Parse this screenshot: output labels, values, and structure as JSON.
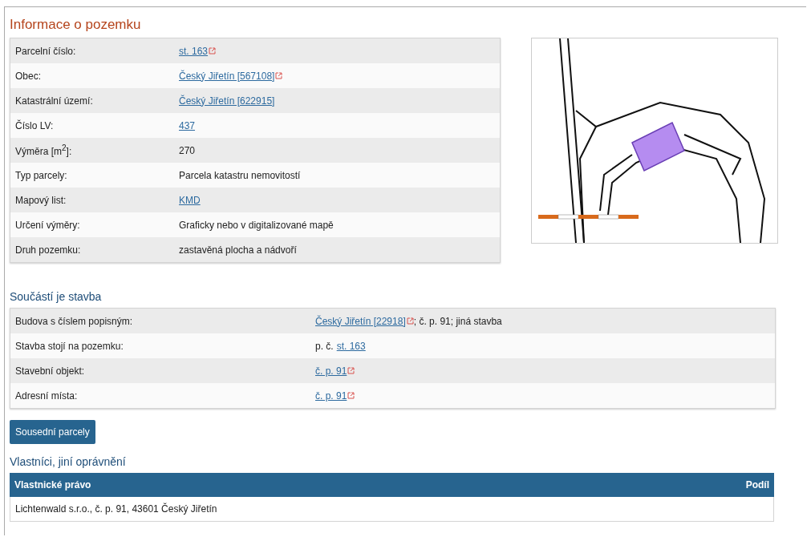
{
  "title": "Informace o pozemku",
  "parcel_rows": [
    {
      "label": "Parcelní číslo:",
      "value": [
        {
          "kind": "link",
          "text": "st. 163",
          "external": true
        }
      ]
    },
    {
      "label": "Obec:",
      "value": [
        {
          "kind": "link",
          "text": "Český Jiřetín [567108]",
          "external": true
        }
      ]
    },
    {
      "label": "Katastrální území:",
      "value": [
        {
          "kind": "link",
          "text": "Český Jiřetín [622915]",
          "external": false
        }
      ]
    },
    {
      "label": "Číslo LV:",
      "value": [
        {
          "kind": "link",
          "text": "437",
          "external": false
        }
      ]
    },
    {
      "label": "Výměra [m$^{2}$]:",
      "value": [
        {
          "kind": "text",
          "text": "270"
        }
      ]
    },
    {
      "label": "Typ parcely:",
      "value": [
        {
          "kind": "text",
          "text": "Parcela katastru nemovitostí"
        }
      ]
    },
    {
      "label": "Mapový list:",
      "value": [
        {
          "kind": "link",
          "text": "KMD",
          "external": false
        }
      ]
    },
    {
      "label": "Určení výměry:",
      "value": [
        {
          "kind": "text",
          "text": "Graficky nebo v digitalizované mapě"
        }
      ]
    },
    {
      "label": "Druh pozemku:",
      "value": [
        {
          "kind": "text",
          "text": "zastavěná plocha a nádvoří"
        }
      ]
    }
  ],
  "building": {
    "heading": "Součástí je stavba",
    "rows": [
      {
        "label": "Budova s číslem popisným:",
        "value": [
          {
            "kind": "link",
            "text": "Český Jiřetín [22918]",
            "external": true
          },
          {
            "kind": "text",
            "text": "; č. p. 91; jiná stavba"
          }
        ]
      },
      {
        "label": "Stavba stojí na pozemku:",
        "value": [
          {
            "kind": "text",
            "text": "p. č."
          },
          {
            "kind": "link",
            "text": "st. 163",
            "external": false
          }
        ]
      },
      {
        "label": "Stavební objekt:",
        "value": [
          {
            "kind": "link",
            "text": "č. p. 91",
            "external": true
          }
        ]
      },
      {
        "label": "Adresní místa:",
        "value": [
          {
            "kind": "link",
            "text": "č. p. 91",
            "external": true
          }
        ]
      }
    ]
  },
  "neighbours_button": "Sousední parcely",
  "owners": {
    "heading": "Vlastníci, jiní oprávnění",
    "columns": [
      "Vlastnické právo",
      "Podíl"
    ],
    "rows": [
      [
        "Lichtenwald s.r.o., č. p. 91, 43601 Český Jiřetín",
        ""
      ]
    ]
  }
}
